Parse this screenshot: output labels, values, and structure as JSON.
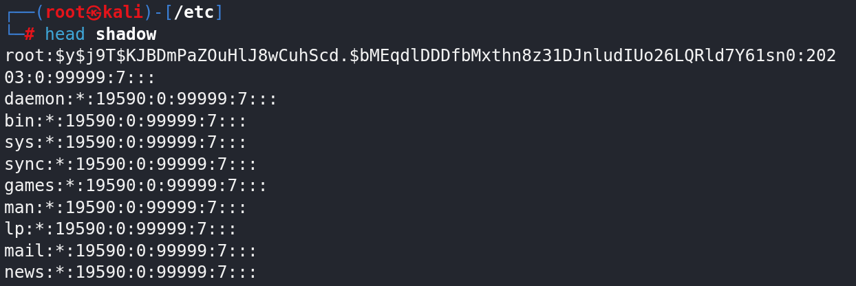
{
  "prompt": {
    "top_corner": "┌──(",
    "user": "root",
    "separator": "㉿",
    "host": "kali",
    "cwd_open": ")-[",
    "cwd": "/etc",
    "cwd_close": "]",
    "bottom_corner": "└─",
    "symbol": "#",
    "command": "head",
    "argument": "shadow"
  },
  "output": [
    "root:$y$j9T$KJBDmPaZOuHlJ8wCuhScd.$bMEqdlDDDfbMxthn8z31DJnludIUo26LQRld7Y61sn0:202",
    "03:0:99999:7:::",
    "daemon:*:19590:0:99999:7:::",
    "bin:*:19590:0:99999:7:::",
    "sys:*:19590:0:99999:7:::",
    "sync:*:19590:0:99999:7:::",
    "games:*:19590:0:99999:7:::",
    "man:*:19590:0:99999:7:::",
    "lp:*:19590:0:99999:7:::",
    "mail:*:19590:0:99999:7:::",
    "news:*:19590:0:99999:7:::"
  ]
}
